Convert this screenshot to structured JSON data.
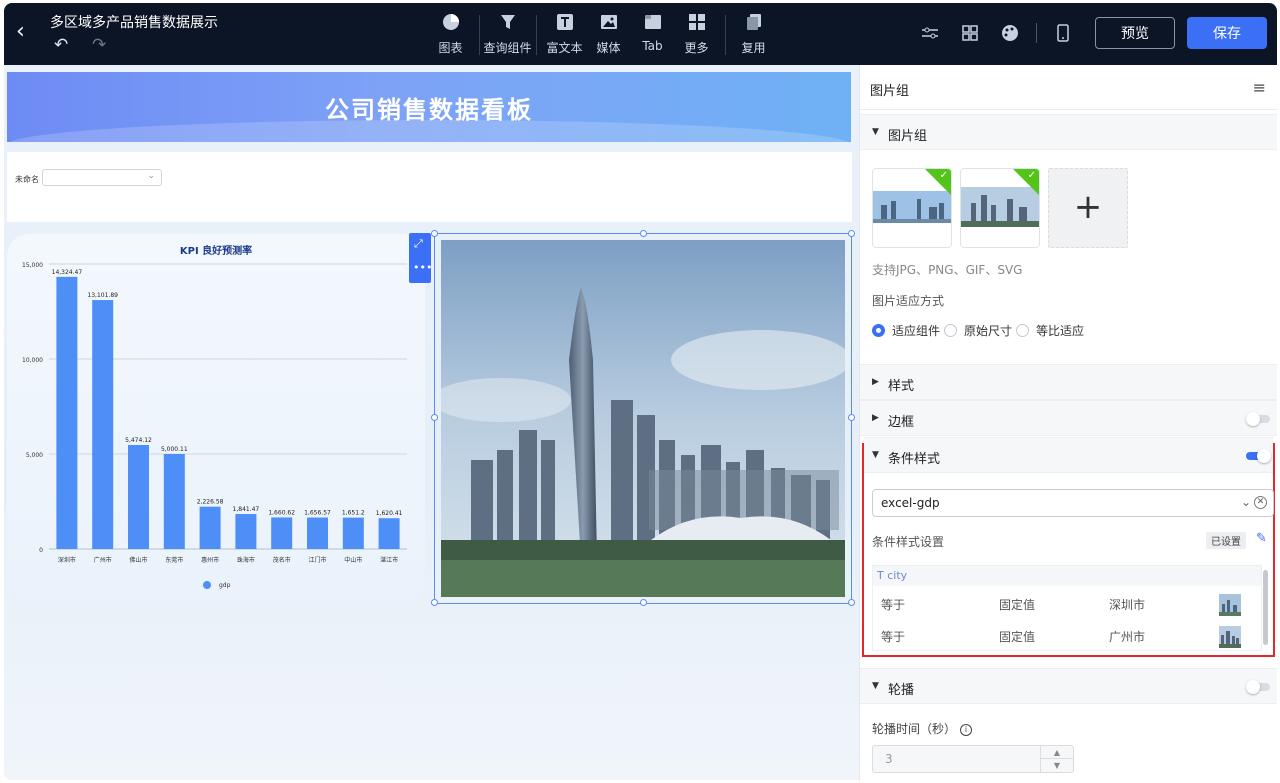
{
  "app": {
    "title": "多区域多产品销售数据展示"
  },
  "toolbar": {
    "tools": [
      {
        "label": "图表",
        "icon": "pie-chart-icon"
      },
      {
        "label": "查询组件",
        "icon": "funnel-icon"
      },
      {
        "label": "富文本",
        "icon": "text-icon"
      },
      {
        "label": "媒体",
        "icon": "image-icon"
      },
      {
        "label": "Tab",
        "icon": "tab-icon"
      },
      {
        "label": "更多",
        "icon": "grid-icon"
      },
      {
        "label": "复用",
        "icon": "copy-icon"
      }
    ],
    "preview_label": "预览",
    "save_label": "保存"
  },
  "canvas": {
    "banner_title": "公司销售数据看板",
    "filter": {
      "label": "未命名",
      "value": ""
    }
  },
  "chart_data": {
    "type": "bar",
    "title": "KPI 良好预测率",
    "categories": [
      "深圳市",
      "广州市",
      "佛山市",
      "东莞市",
      "惠州市",
      "珠海市",
      "茂名市",
      "江门市",
      "中山市",
      "湛江市"
    ],
    "series": [
      {
        "name": "gdp",
        "values": [
          14324.47,
          13101.89,
          5474.12,
          5000.11,
          2226.58,
          1841.47,
          1660.62,
          1656.57,
          1651.2,
          1620.41
        ]
      }
    ],
    "value_labels": [
      "14,324.47",
      "13,101.89",
      "5,474.12",
      "5,000.11",
      "2,226.58",
      "1,841.47",
      "1,660.62",
      "1,656.57",
      "1,651.2",
      "1,620.41"
    ],
    "yticks": [
      "0",
      "5,000",
      "10,000",
      "15,000"
    ],
    "ylim": [
      0,
      15000
    ],
    "bar_color": "#4e8ef7",
    "legend": "bottom-center",
    "grid": true
  },
  "panel": {
    "header": "图片组",
    "group_section": "图片组",
    "support_hint": "支持JPG、PNG、GIF、SVG",
    "fit_label": "图片适应方式",
    "fit_options": [
      "适应组件",
      "原始尺寸",
      "等比适应"
    ],
    "fit_selected": "适应组件",
    "style_section": "样式",
    "border_section": "边框",
    "border_enabled": false,
    "cond_section": "条件样式",
    "cond_enabled": true,
    "dataset_value": "excel-gdp",
    "cond_settings_label": "条件样式设置",
    "cond_badge": "已设置",
    "cond_field": "city",
    "cond_rows": [
      {
        "op": "等于",
        "type": "固定值",
        "value": "深圳市"
      },
      {
        "op": "等于",
        "type": "固定值",
        "value": "广州市"
      }
    ],
    "carousel_section": "轮播",
    "carousel_enabled": false,
    "carousel_time_label": "轮播时间（秒）",
    "carousel_time_value": "3"
  },
  "colors": {
    "accent": "#3b6ff5",
    "topbar": "#0b1526",
    "highlight": "#e2282d",
    "check": "#52c41a"
  }
}
